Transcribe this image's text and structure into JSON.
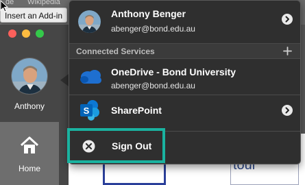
{
  "background": {
    "toolbar_texts": [
      "de",
      "Wikipedia"
    ],
    "tooltip": "Insert an Add-in",
    "sidebar": {
      "user_name": "Anthony",
      "home_label": "Home"
    },
    "content_text": "tour"
  },
  "account": {
    "name": "Anthony Benger",
    "email": "abenger@bond.edu.au"
  },
  "connected_services": {
    "title": "Connected Services",
    "items": [
      {
        "name": "OneDrive - Bond University",
        "subtitle": "abenger@bond.edu.au",
        "icon": "onedrive-icon"
      },
      {
        "name": "SharePoint",
        "icon": "sharepoint-icon"
      }
    ]
  },
  "sign_out": {
    "label": "Sign Out",
    "icon": "close-circle-icon"
  },
  "colors": {
    "panel_bg": "#2f2f2f",
    "highlight": "#1ab3a0",
    "onedrive_blue": "#1e6fd0",
    "sharepoint_blue": "#0c78d4"
  }
}
